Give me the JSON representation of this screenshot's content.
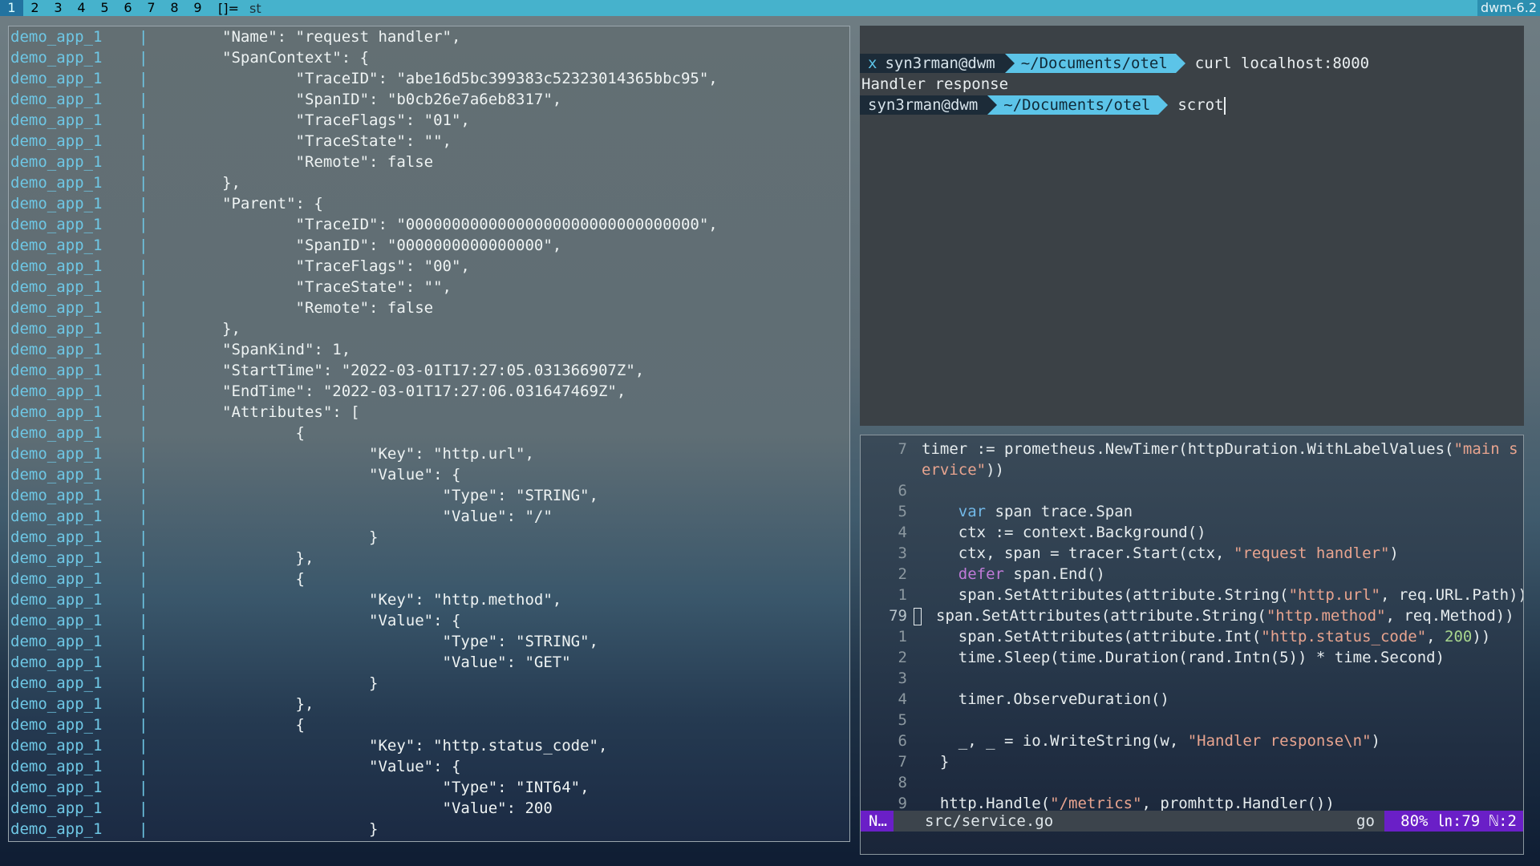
{
  "bar": {
    "tags": [
      "1",
      "2",
      "3",
      "4",
      "5",
      "6",
      "7",
      "8",
      "9"
    ],
    "selected_tag": "1",
    "layout": "[]=",
    "window_title": "st",
    "status": "dwm-6.2"
  },
  "left_terminal": {
    "prefix": "demo_app_1",
    "pipe": "|",
    "lines": [
      "\"Name\": \"request handler\",",
      "\"SpanContext\": {",
      "        \"TraceID\": \"abe16d5bc399383c52323014365bbc95\",",
      "        \"SpanID\": \"b0cb26e7a6eb8317\",",
      "        \"TraceFlags\": \"01\",",
      "        \"TraceState\": \"\",",
      "        \"Remote\": false",
      "},",
      "\"Parent\": {",
      "        \"TraceID\": \"00000000000000000000000000000000\",",
      "        \"SpanID\": \"0000000000000000\",",
      "        \"TraceFlags\": \"00\",",
      "        \"TraceState\": \"\",",
      "        \"Remote\": false",
      "},",
      "\"SpanKind\": 1,",
      "\"StartTime\": \"2022-03-01T17:27:05.031366907Z\",",
      "\"EndTime\": \"2022-03-01T17:27:06.031647469Z\",",
      "\"Attributes\": [",
      "        {",
      "                \"Key\": \"http.url\",",
      "                \"Value\": {",
      "                        \"Type\": \"STRING\",",
      "                        \"Value\": \"/\"",
      "                }",
      "        },",
      "        {",
      "                \"Key\": \"http.method\",",
      "                \"Value\": {",
      "                        \"Type\": \"STRING\",",
      "                        \"Value\": \"GET\"",
      "                }",
      "        },",
      "        {",
      "                \"Key\": \"http.status_code\",",
      "                \"Value\": {",
      "                        \"Type\": \"INT64\",",
      "                        \"Value\": 200",
      "                }",
      "        }"
    ]
  },
  "top_terminal": {
    "x_mark": "x",
    "user": "syn3rman@dwm",
    "dir": "~/Documents/otel",
    "cmd1": "curl localhost:8000",
    "output": "Handler response",
    "cmd2": "scrot"
  },
  "editor": {
    "lines": [
      {
        "n": "7",
        "html": "timer := prometheus.NewTimer(httpDuration.WithLabelValues(<span class=\"str\">\"main s</span>"
      },
      {
        "n": "",
        "html": "<span class=\"str\">ervice\"</span>))"
      },
      {
        "n": "6",
        "html": ""
      },
      {
        "n": "5",
        "html": "    <span class=\"kw\">var</span> span trace.Span"
      },
      {
        "n": "4",
        "html": "    ctx := context.Background()"
      },
      {
        "n": "3",
        "html": "    ctx, span = tracer.Start(ctx, <span class=\"str\">\"request handler\"</span>)"
      },
      {
        "n": "2",
        "html": "    <span class=\"kw2\">defer</span> span.End()"
      },
      {
        "n": "1",
        "html": "    span.SetAttributes(attribute.String(<span class=\"str\">\"http.url\"</span>, req.URL.Path))"
      },
      {
        "n": "79",
        "html": "span.SetAttributes(attribute.String(<span class=\"str\">\"http.method\"</span>, req.Method))",
        "cursor": true
      },
      {
        "n": "1",
        "html": "    span.SetAttributes(attribute.Int(<span class=\"str\">\"http.status_code\"</span>, <span class=\"num\">200</span>))"
      },
      {
        "n": "2",
        "html": "    time.Sleep(time.Duration(rand.Intn(5)) * time.Second)"
      },
      {
        "n": "3",
        "html": ""
      },
      {
        "n": "4",
        "html": "    timer.ObserveDuration()"
      },
      {
        "n": "5",
        "html": ""
      },
      {
        "n": "6",
        "html": "    _, _ = io.WriteString(w, <span class=\"str\">\"Handler response\\n\"</span>)"
      },
      {
        "n": "7",
        "html": "  }"
      },
      {
        "n": "8",
        "html": ""
      },
      {
        "n": "9",
        "html": "  http.Handle(<span class=\"str\">\"/metrics\"</span>, promhttp.Handler())"
      }
    ],
    "status": {
      "mode": "N…",
      "file": "src/service.go",
      "filetype": "go",
      "position": "80% ㏑:79 ℕ:2"
    }
  }
}
